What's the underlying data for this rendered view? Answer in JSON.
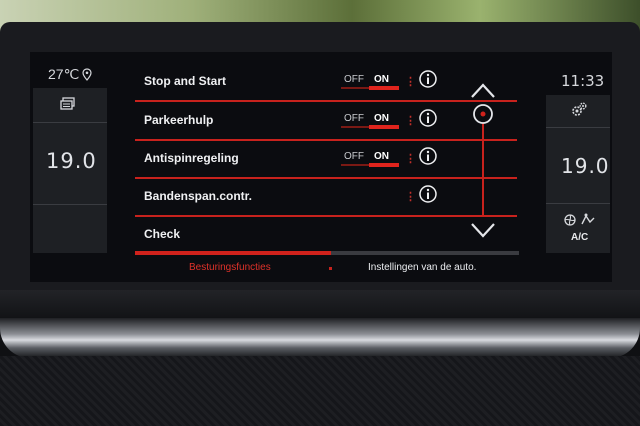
{
  "status": {
    "outside_temp": "27℃",
    "clock": "11:33"
  },
  "climate": {
    "left_temp": "19.0",
    "right_temp": "19.0",
    "ac_label": "A/C"
  },
  "menu": {
    "items": [
      {
        "label": "Stop and Start",
        "off": "OFF",
        "on": "ON",
        "state": "ON",
        "has_toggle": true
      },
      {
        "label": "Parkeerhulp",
        "off": "OFF",
        "on": "ON",
        "state": "ON",
        "has_toggle": true
      },
      {
        "label": "Antispinregeling",
        "off": "OFF",
        "on": "ON",
        "state": "ON",
        "has_toggle": true
      },
      {
        "label": "Bandenspan.contr.",
        "has_toggle": false
      },
      {
        "label": "Check",
        "has_toggle": false
      }
    ]
  },
  "tabs": [
    {
      "label": "Besturingsfuncties",
      "active": true
    },
    {
      "label": "Instellingen van de auto.",
      "active": false
    }
  ],
  "icons": {
    "location": "location-pin-icon",
    "grid": "grid-icon",
    "gear": "gear-icon",
    "fan": "fan-icon",
    "info": "info-icon",
    "scroll_up": "chevron-up-icon",
    "scroll_down": "chevron-down-icon"
  },
  "colors": {
    "accent": "#d0221c",
    "text": "#f0f1f3",
    "screen_bg": "#0b0c10"
  }
}
